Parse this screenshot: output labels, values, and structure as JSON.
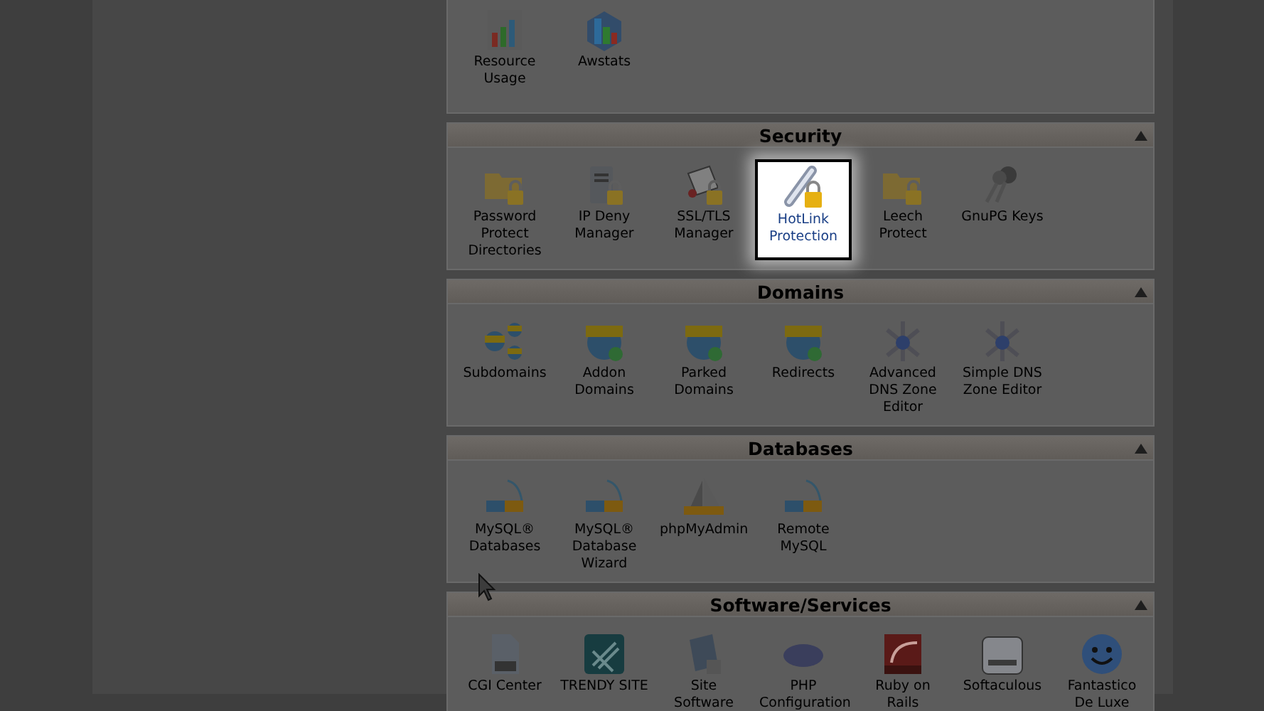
{
  "sections": [
    {
      "items": [
        {
          "label": "Resource Usage",
          "highlighted": false
        },
        {
          "label": "Awstats",
          "highlighted": false
        }
      ]
    },
    {
      "title": "Security",
      "expanded": true,
      "items": [
        {
          "label": "Password Protect Directories",
          "highlighted": false
        },
        {
          "label": "IP Deny Manager",
          "highlighted": false
        },
        {
          "label": "SSL/TLS Manager",
          "highlighted": false
        },
        {
          "label": "HotLink Protection",
          "highlighted": true
        },
        {
          "label": "Leech Protect",
          "highlighted": false
        },
        {
          "label": "GnuPG Keys",
          "highlighted": false
        }
      ]
    },
    {
      "title": "Domains",
      "expanded": true,
      "items": [
        {
          "label": "Subdomains",
          "highlighted": false
        },
        {
          "label": "Addon Domains",
          "highlighted": false
        },
        {
          "label": "Parked Domains",
          "highlighted": false
        },
        {
          "label": "Redirects",
          "highlighted": false
        },
        {
          "label": "Advanced DNS Zone Editor",
          "highlighted": false
        },
        {
          "label": "Simple DNS Zone Editor",
          "highlighted": false
        }
      ]
    },
    {
      "title": "Databases",
      "expanded": true,
      "items": [
        {
          "label": "MySQL® Databases",
          "highlighted": false
        },
        {
          "label": "MySQL® Database Wizard",
          "highlighted": false
        },
        {
          "label": "phpMyAdmin",
          "highlighted": false
        },
        {
          "label": "Remote MySQL",
          "highlighted": false
        }
      ]
    },
    {
      "title": "Software/Services",
      "expanded": true,
      "items": [
        {
          "label": "CGI Center",
          "highlighted": false
        },
        {
          "label": "TRENDY SITE",
          "highlighted": false
        },
        {
          "label": "Site Software",
          "highlighted": false
        },
        {
          "label": "PHP Configuration",
          "highlighted": false
        },
        {
          "label": "Ruby on Rails",
          "highlighted": false
        },
        {
          "label": "Softaculous",
          "highlighted": false
        },
        {
          "label": "Fantastico De Luxe",
          "highlighted": false
        }
      ]
    }
  ]
}
